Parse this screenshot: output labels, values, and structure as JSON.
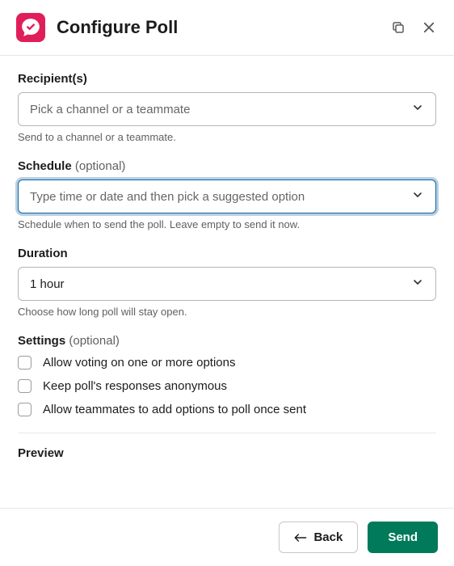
{
  "header": {
    "title": "Configure Poll"
  },
  "recipients": {
    "label": "Recipient(s)",
    "placeholder": "Pick a channel or a teammate",
    "hint": "Send to a channel or a teammate."
  },
  "schedule": {
    "label": "Schedule",
    "optional": "(optional)",
    "placeholder": "Type time or date and then pick a suggested option",
    "hint": "Schedule when to send the poll. Leave empty to send it now."
  },
  "duration": {
    "label": "Duration",
    "value": "1 hour",
    "hint": "Choose how long poll will stay open."
  },
  "settings": {
    "label": "Settings",
    "optional": "(optional)",
    "options": [
      "Allow voting on one or more options",
      "Keep poll's responses anonymous",
      "Allow teammates to add options to poll once sent"
    ]
  },
  "preview": {
    "label": "Preview"
  },
  "footer": {
    "back": "Back",
    "send": "Send"
  }
}
